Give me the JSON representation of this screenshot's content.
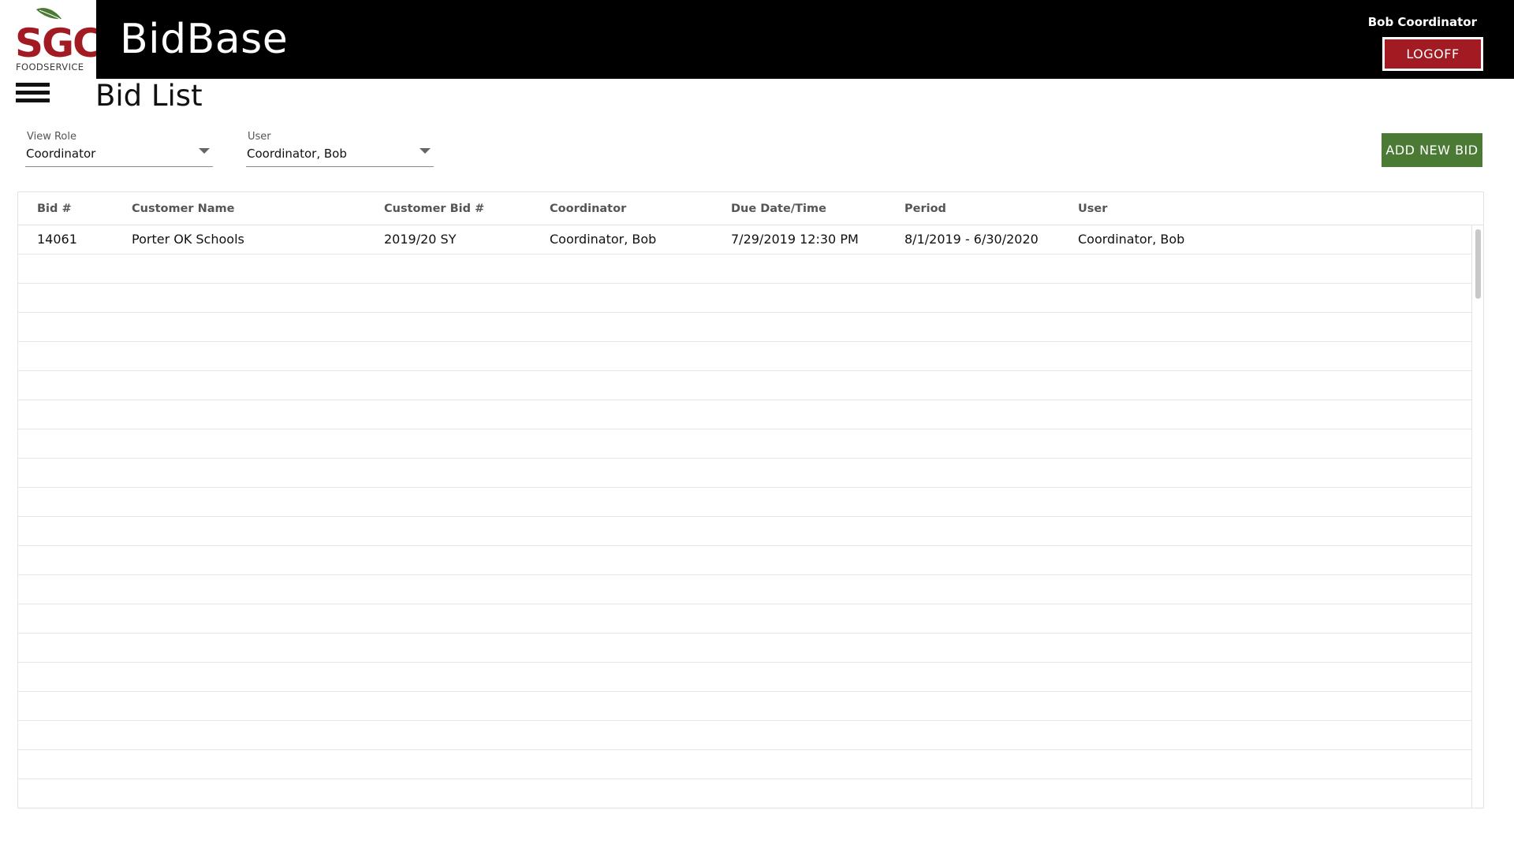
{
  "header": {
    "logo_text": "SGC",
    "logo_subtitle": "FOODSERVICE",
    "app_title": "BidBase",
    "user_name": "Bob Coordinator",
    "logoff_label": "LOGOFF"
  },
  "page": {
    "title": "Bid List"
  },
  "filters": {
    "view_role": {
      "label": "View Role",
      "value": "Coordinator"
    },
    "user": {
      "label": "User",
      "value": "Coordinator, Bob"
    },
    "add_label": "ADD NEW BID"
  },
  "grid": {
    "columns": [
      "Bid #",
      "Customer Name",
      "Customer Bid #",
      "Coordinator",
      "Due Date/Time",
      "Period",
      "User"
    ],
    "rows": [
      [
        "14061",
        "Porter OK Schools",
        "2019/20 SY",
        "Coordinator, Bob",
        "7/29/2019 12:30 PM",
        "8/1/2019 - 6/30/2020",
        "Coordinator, Bob"
      ]
    ]
  },
  "colors": {
    "header_bg": "#000000",
    "logoff_red": "#a31b22",
    "add_green": "#4a7a34",
    "logo_red": "#a31b22",
    "logo_leaf": "#4a7a34"
  }
}
